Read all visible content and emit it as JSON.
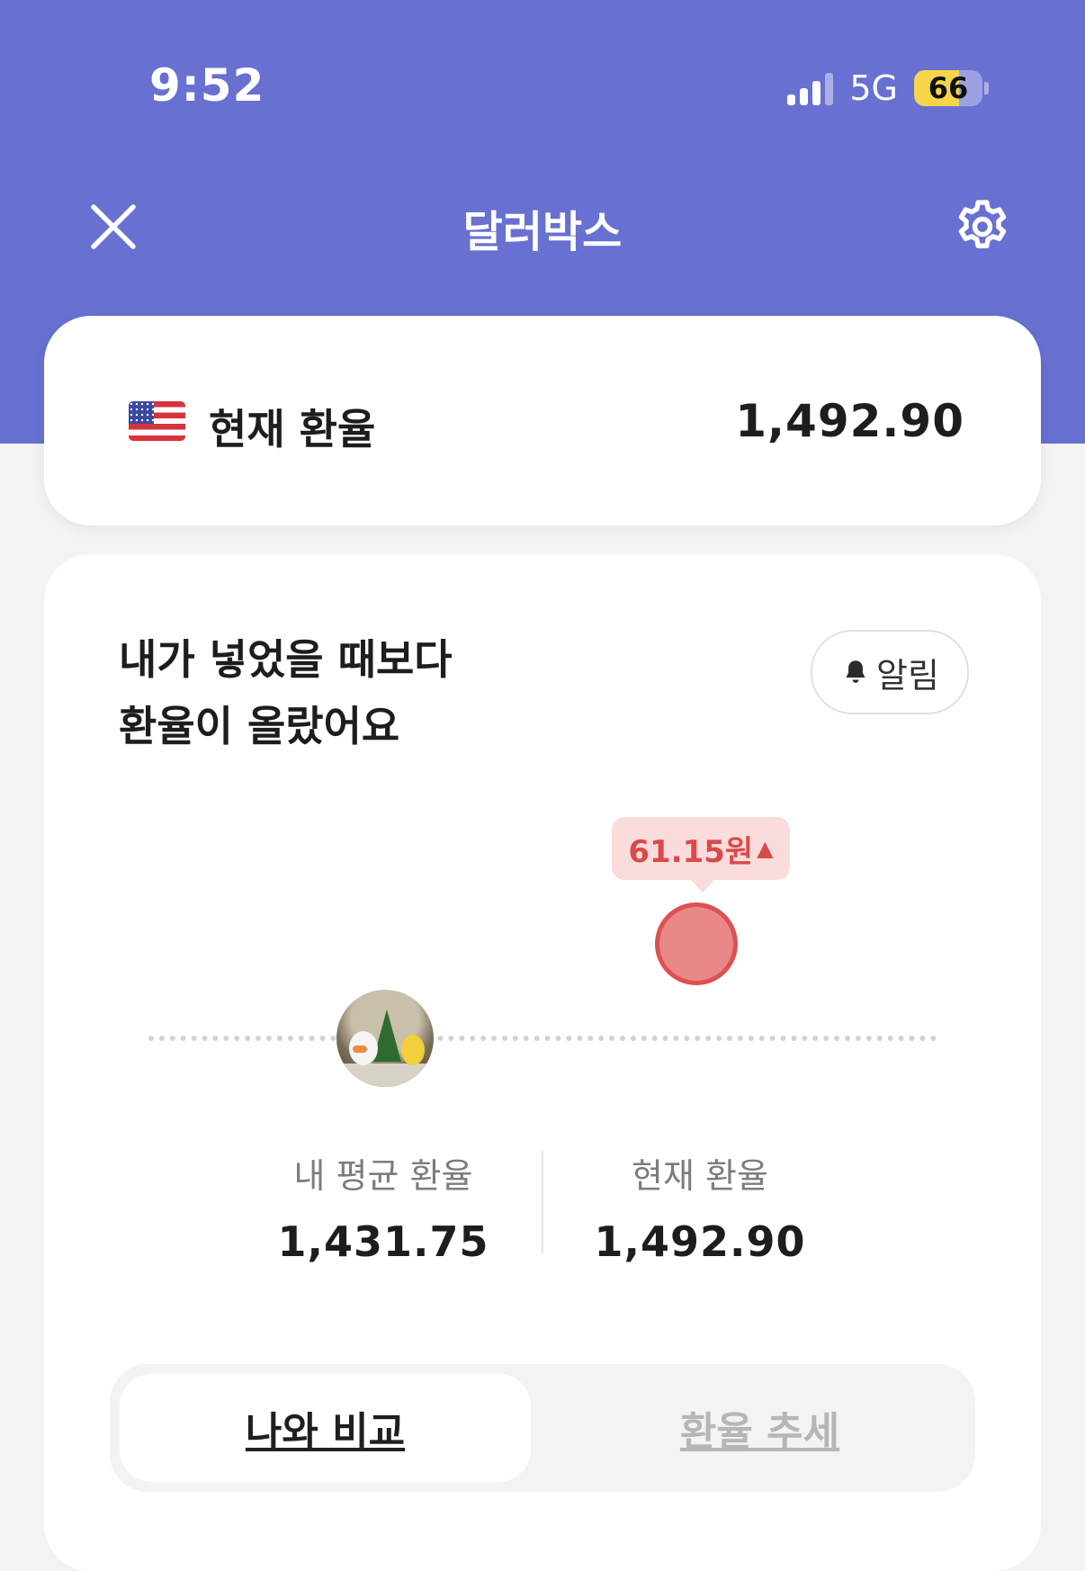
{
  "status_bar": {
    "time": "9:52",
    "network": "5G",
    "battery": "66",
    "battery_level": 0.66
  },
  "nav": {
    "title": "달러박스",
    "close_icon": "close-icon",
    "settings_icon": "gear-icon"
  },
  "rate_card": {
    "flag_icon": "us-flag-icon",
    "label": "현재 환율",
    "value": "1,492.90"
  },
  "compare": {
    "headline_line1": "내가 넣었을 때보다",
    "headline_line2": "환율이 올랐어요",
    "alarm_label": "알림",
    "alarm_icon": "bell-icon",
    "diff_text": "61.15원",
    "diff_arrow": "▲",
    "my_avg_label": "내 평균 환율",
    "my_avg_value": "1,431.75",
    "current_label": "현재 환율",
    "current_value": "1,492.90"
  },
  "tabs": [
    {
      "label": "나와 비교",
      "active": true
    },
    {
      "label": "환율 추세",
      "active": false
    }
  ],
  "colors": {
    "header": "#6870d1",
    "accent_red": "#dd5150",
    "badge_bg": "#fbdcdc",
    "battery": "#f6d54a"
  }
}
